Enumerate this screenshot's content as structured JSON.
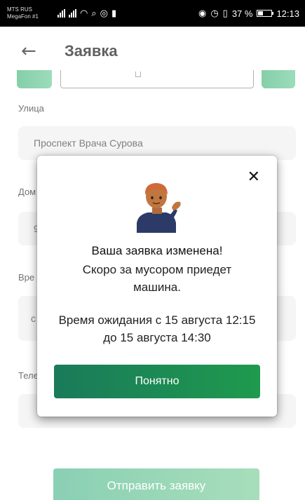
{
  "status_bar": {
    "carrier_line1": "MTS RUS",
    "carrier_line2": "MegaFon #1",
    "battery_text": "37 %",
    "time": "12:13"
  },
  "header": {
    "back_icon": "arrow-left-icon",
    "title": "Заявка"
  },
  "form": {
    "street_label": "Улица",
    "street_value": "Проспект Врача Сурова",
    "house_label_partial": "Дом",
    "house_value_partial": "9",
    "time_label_partial": "Вре",
    "time_value_partial": "с",
    "phone_label_partial": "Теле",
    "submit_label": "Отправить заявку"
  },
  "modal": {
    "close_icon": "close-icon",
    "emoji_icon": "person-tipping-hand-icon",
    "title": "Ваша заявка изменена!",
    "subtitle": "Скоро за мусором приедет машина.",
    "wait_text": "Время ожидания с 15 августа 12:15 до 15 августа 14:30",
    "ok_label": "Понятно"
  },
  "colors": {
    "accent_green": "#1f9a4e",
    "accent_green_dark": "#1a7a5a",
    "submit_green": "#6fc79f"
  }
}
